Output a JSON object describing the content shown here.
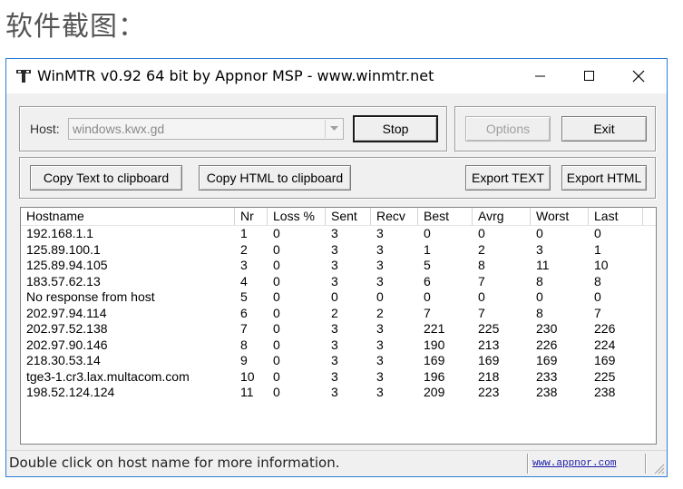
{
  "page_heading": "软件截图：",
  "window": {
    "title": "WinMTR v0.92 64 bit by Appnor MSP - www.winmtr.net",
    "app_icon": "winmtr-app-icon",
    "controls": {
      "minimize": "minimize-icon",
      "maximize": "maximize-icon",
      "close": "close-icon"
    }
  },
  "host": {
    "label": "Host:",
    "value": "windows.kwx.gd",
    "dropdown_icon": "chevron-down-icon"
  },
  "buttons": {
    "stop": "Stop",
    "options": "Options",
    "exit": "Exit",
    "copy_text": "Copy Text to clipboard",
    "copy_html": "Copy HTML to clipboard",
    "export_text": "Export TEXT",
    "export_html": "Export HTML"
  },
  "table": {
    "columns": [
      "Hostname",
      "Nr",
      "Loss %",
      "Sent",
      "Recv",
      "Best",
      "Avrg",
      "Worst",
      "Last"
    ],
    "rows": [
      [
        "192.168.1.1",
        "1",
        "0",
        "3",
        "3",
        "0",
        "0",
        "0",
        "0"
      ],
      [
        "125.89.100.1",
        "2",
        "0",
        "3",
        "3",
        "1",
        "2",
        "3",
        "1"
      ],
      [
        "125.89.94.105",
        "3",
        "0",
        "3",
        "3",
        "5",
        "8",
        "11",
        "10"
      ],
      [
        "183.57.62.13",
        "4",
        "0",
        "3",
        "3",
        "6",
        "7",
        "8",
        "8"
      ],
      [
        "No response from host",
        "5",
        "0",
        "0",
        "0",
        "0",
        "0",
        "0",
        "0"
      ],
      [
        "202.97.94.114",
        "6",
        "0",
        "2",
        "2",
        "7",
        "7",
        "8",
        "7"
      ],
      [
        "202.97.52.138",
        "7",
        "0",
        "3",
        "3",
        "221",
        "225",
        "230",
        "226"
      ],
      [
        "202.97.90.146",
        "8",
        "0",
        "3",
        "3",
        "190",
        "213",
        "226",
        "224"
      ],
      [
        "218.30.53.14",
        "9",
        "0",
        "3",
        "3",
        "169",
        "169",
        "169",
        "169"
      ],
      [
        "tge3-1.cr3.lax.multacom.com",
        "10",
        "0",
        "3",
        "3",
        "196",
        "218",
        "233",
        "225"
      ],
      [
        "198.52.124.124",
        "11",
        "0",
        "3",
        "3",
        "209",
        "223",
        "238",
        "238"
      ]
    ]
  },
  "status": {
    "message": "Double click on host name for more information.",
    "link": "www.appnor.com",
    "grip_icon": "resize-grip-icon"
  },
  "colors": {
    "window_border": "#2b7fd6",
    "link": "#1a1aa8",
    "disabled_text": "#a0a0a0"
  }
}
